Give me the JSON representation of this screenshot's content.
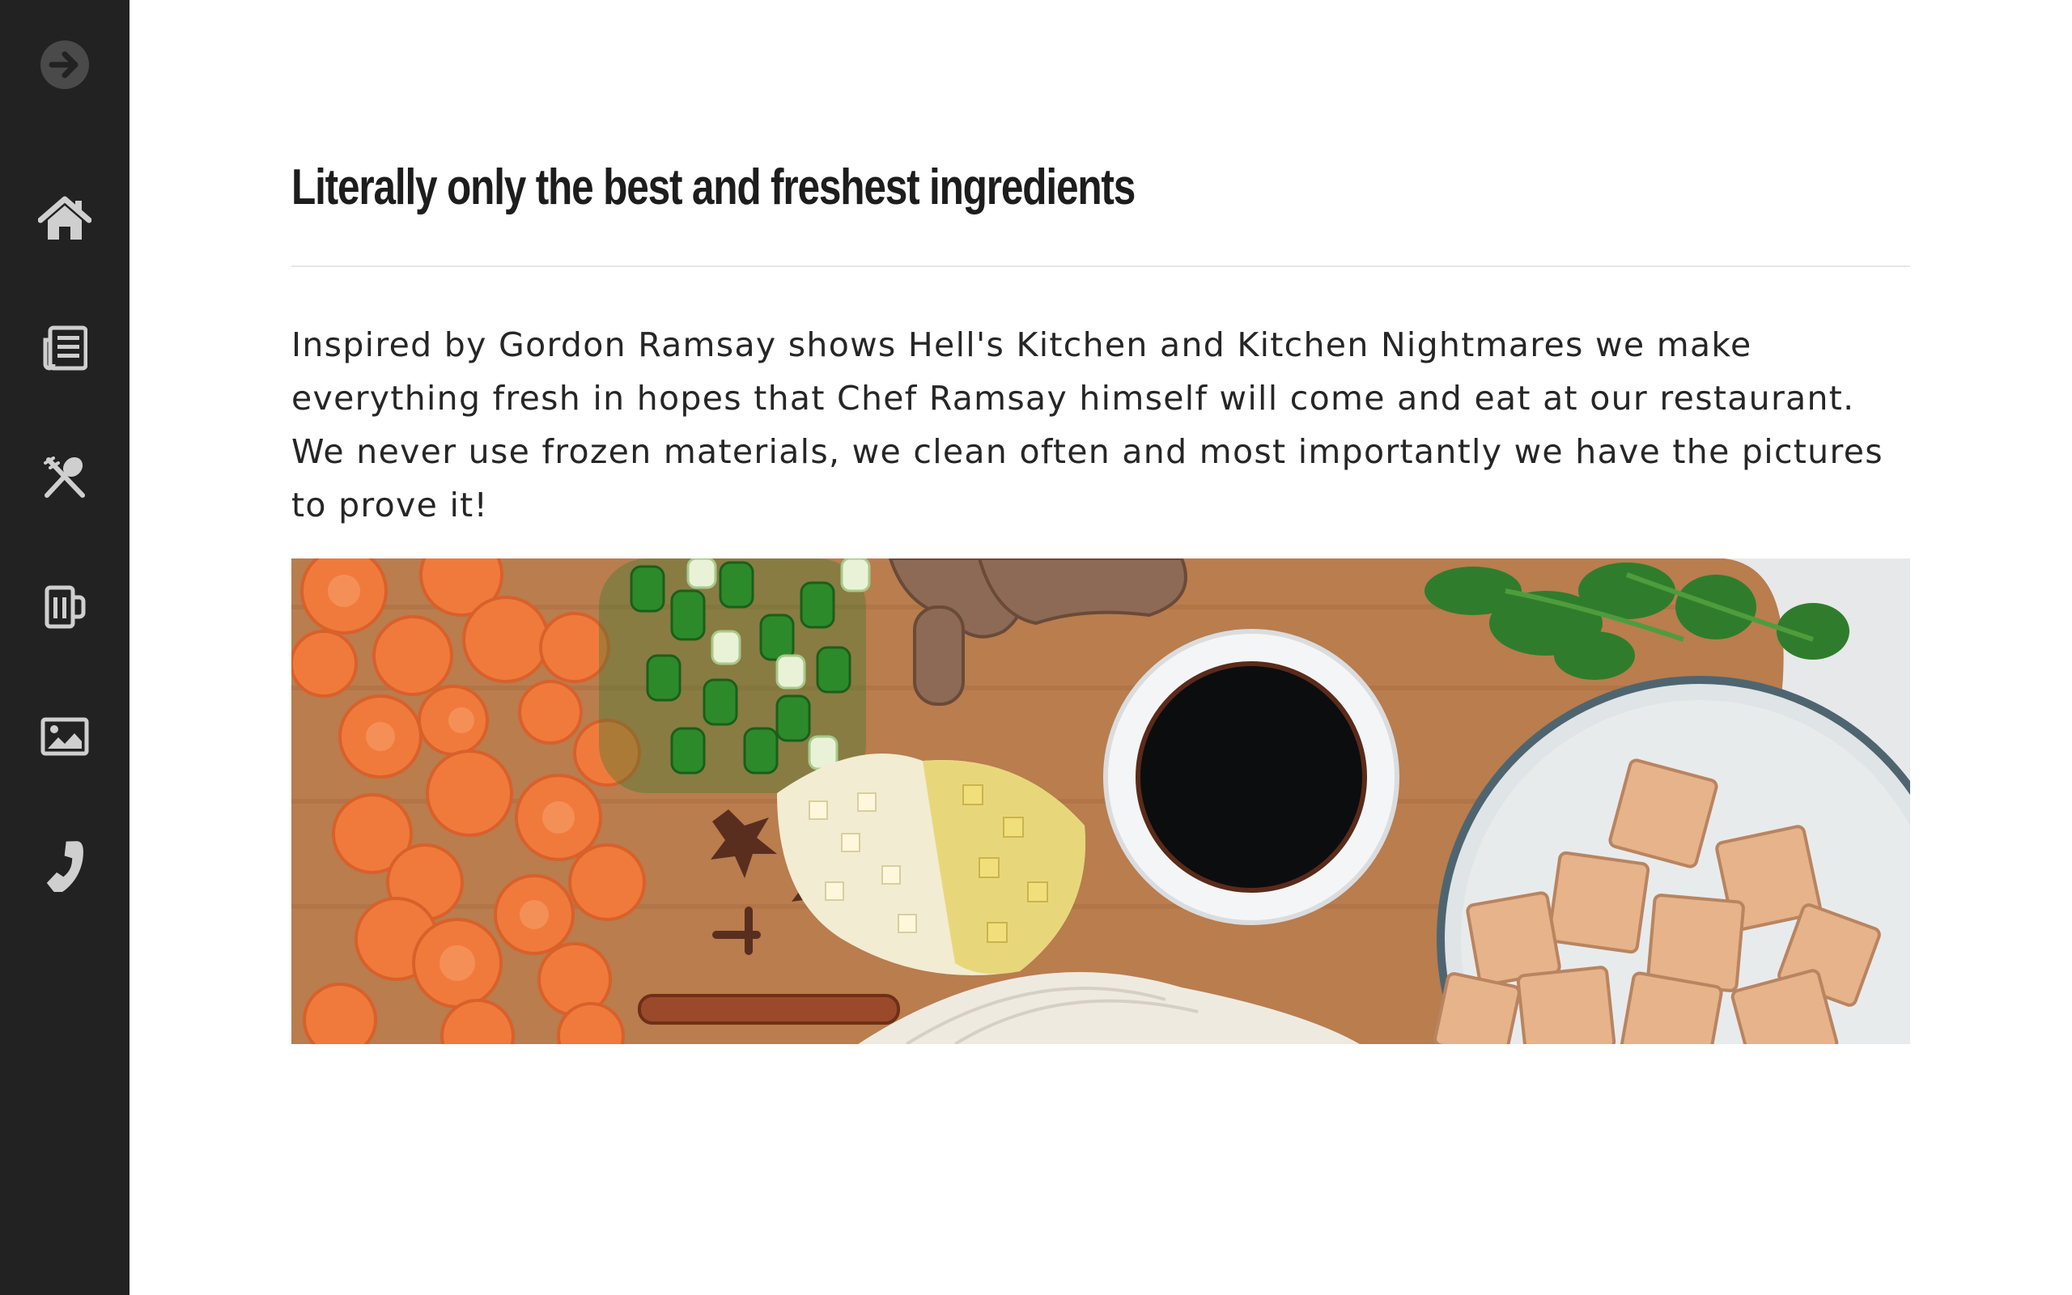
{
  "sidebar": {
    "toggle_icon": "arrow-right-circle-icon",
    "items": [
      {
        "id": "home",
        "icon": "home-icon"
      },
      {
        "id": "about",
        "icon": "newspaper-icon"
      },
      {
        "id": "menu",
        "icon": "utensils-icon"
      },
      {
        "id": "drinks",
        "icon": "beer-mug-icon"
      },
      {
        "id": "gallery",
        "icon": "image-icon"
      },
      {
        "id": "contact",
        "icon": "phone-icon"
      }
    ]
  },
  "main": {
    "title": "Literally only the best and freshest ingredients",
    "body": "Inspired by Gordon Ramsay shows Hell's Kitchen and Kitchen Nightmares we make everything fresh in hopes that Chef Ramsay himself will come and eat at our restaurant. We never use frozen materials, we clean often and most importantly we have the pictures to prove it!",
    "image_subject": "ingredients-photo"
  },
  "colors": {
    "sidebar_bg": "#222222",
    "icon_color": "#cfcfcf",
    "toggle_color": "#4a4a4a",
    "title_color": "#1d1d1d",
    "text_color": "#262626",
    "divider": "#e6e6e6"
  }
}
